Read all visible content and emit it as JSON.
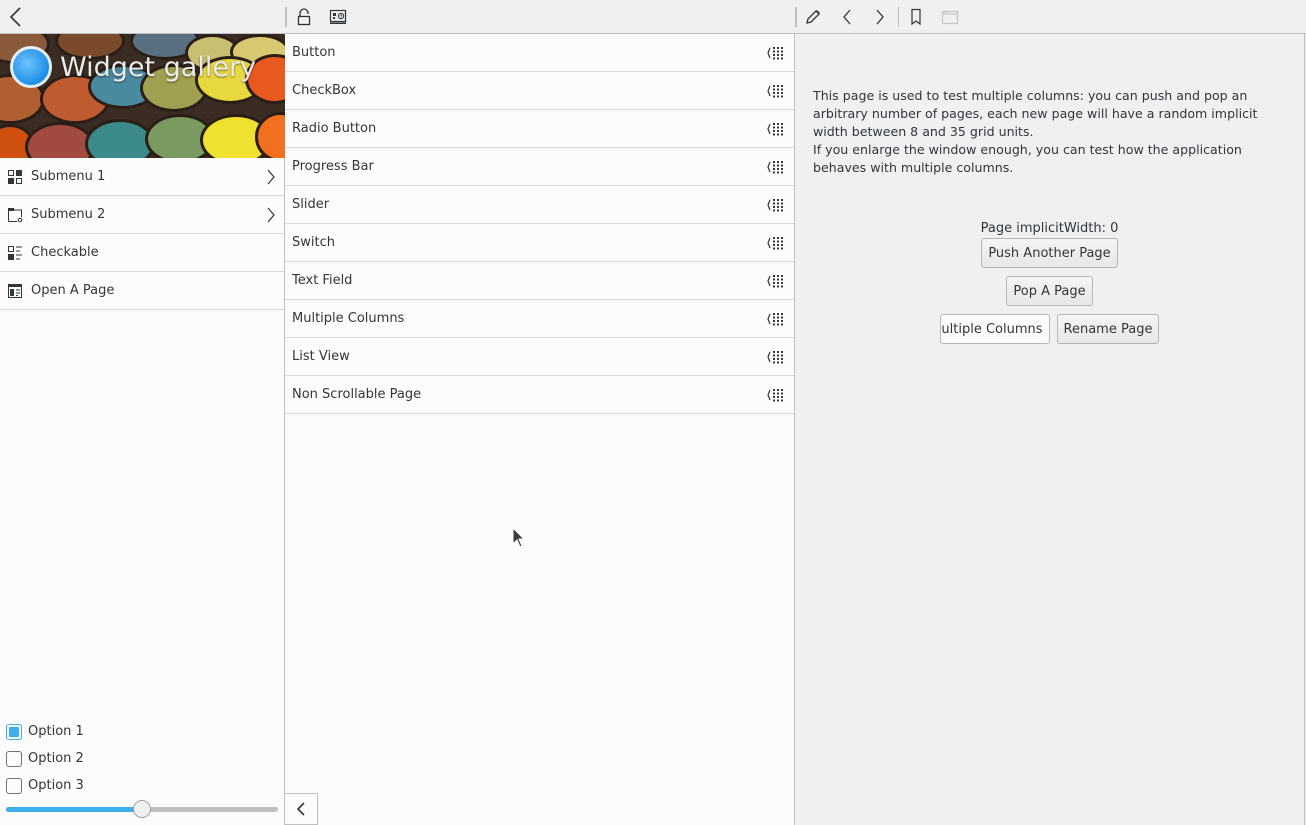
{
  "toolbar": {
    "back_icon": "chevron-left-icon",
    "lock_icon": "lock-icon",
    "settings_icon": "panel-clock-icon",
    "edit_icon": "pencil-icon",
    "prev_icon": "chevron-left-icon",
    "next_icon": "chevron-right-icon",
    "bookmark_icon": "bookmark-icon",
    "folder_icon": "folder-icon-disabled"
  },
  "drawer": {
    "title": "Widget gallery",
    "items": [
      {
        "label": "Submenu 1",
        "icon": "view-grid-icon",
        "has_submenu": true
      },
      {
        "label": "Submenu 2",
        "icon": "folder-edit-icon",
        "has_submenu": true
      },
      {
        "label": "Checkable",
        "icon": "checklist-icon",
        "has_submenu": false
      },
      {
        "label": "Open A Page",
        "icon": "page-layout-icon",
        "has_submenu": false
      }
    ],
    "options": [
      {
        "label": "Option 1",
        "checked": true
      },
      {
        "label": "Option 2",
        "checked": false
      },
      {
        "label": "Option 3",
        "checked": false
      }
    ],
    "slider": {
      "value": 0.5
    }
  },
  "gallery_list": {
    "items": [
      "Button",
      "CheckBox",
      "Radio Button",
      "Progress Bar",
      "Slider",
      "Switch",
      "Text Field",
      "Multiple Columns",
      "List View",
      "Non Scrollable Page"
    ]
  },
  "page": {
    "description_line1": "This page is used to test multiple columns: you can push and pop an arbitrary number of pages, each new page will have a random implicit width between 8 and 35 grid units.",
    "description_line2": "If you enlarge the window enough, you can test how the application behaves with multiple columns.",
    "implicit_width_label": "Page implicitWidth: 0",
    "push_button": "Push Another Page",
    "pop_button": "Pop A Page",
    "multiple_columns_button": "Multiple Columns",
    "rename_button": "Rename Page"
  },
  "colors": {
    "accent": "#3daee9",
    "text": "#31363b",
    "window_bg": "#eff0f1",
    "view_bg": "#fcfcfc",
    "divider": "#d6d7d8"
  }
}
